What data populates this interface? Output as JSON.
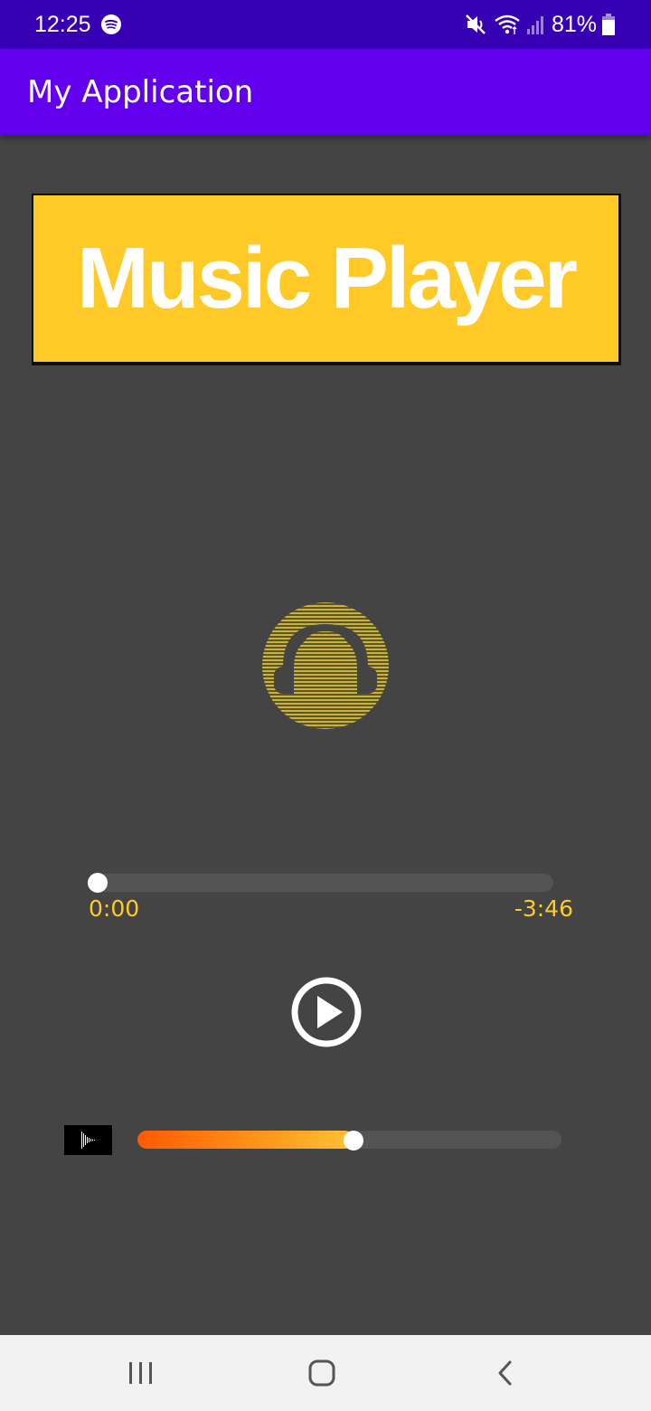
{
  "status_bar": {
    "time": "12:25",
    "battery": "81%",
    "icons": [
      "spotify-icon",
      "mute-icon",
      "wifi-icon",
      "signal-icon",
      "battery-icon"
    ]
  },
  "app_bar": {
    "title": "My Application"
  },
  "banner": {
    "text": "Music Player"
  },
  "player": {
    "elapsed": "0:00",
    "remaining": "-3:46",
    "seek_progress": 0,
    "volume_level": 0.51,
    "play_icon": "play-circle-icon",
    "album_icon": "headphones-icon"
  },
  "nav_bar": {
    "buttons": [
      "recents-icon",
      "home-icon",
      "back-icon"
    ]
  },
  "colors": {
    "status_bar": "#3700b3",
    "app_bar": "#6200ee",
    "background": "#444444",
    "accent": "#ffca28",
    "volume_start": "#ff5a00",
    "volume_end": "#ffc233"
  }
}
